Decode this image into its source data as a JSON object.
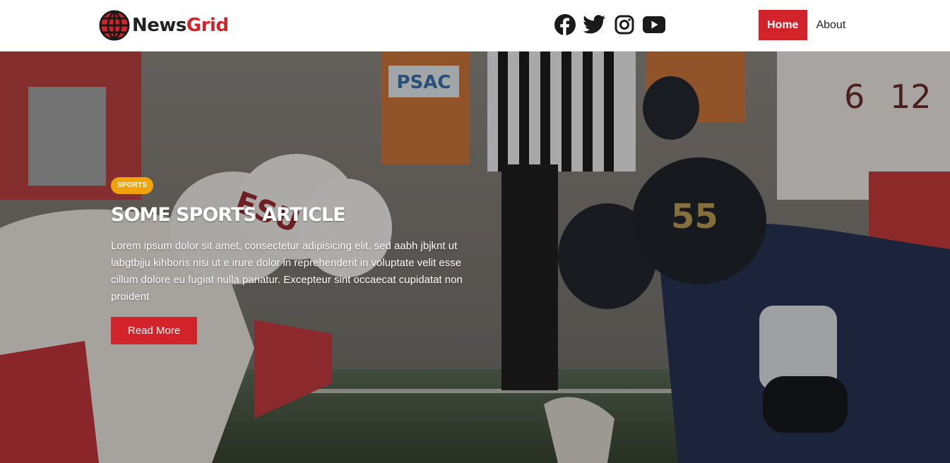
{
  "brand": {
    "name_part1": "News",
    "name_part2": "Grid",
    "logo_icon": "globe-icon",
    "accent": "#d2232a"
  },
  "social": [
    {
      "name": "facebook-icon"
    },
    {
      "name": "twitter-icon"
    },
    {
      "name": "instagram-icon"
    },
    {
      "name": "youtube-icon"
    }
  ],
  "nav": {
    "home_label": "Home",
    "about_label": "About"
  },
  "hero": {
    "category": "SPORTS",
    "category_color": "#f0a30a",
    "title": "Some Sports Article",
    "excerpt": "Lorem ipsum dolor sit amet, consectetur adipisicing elit, sed aabh jbjknt ut labgtbjju kihboris nisi ut e irure dolor in reprehenderit in voluptate velit esse cillum dolore eu fugiat nulla pariatur. Excepteur sint occaecat cupidatat non proident",
    "button_label": "Read More",
    "button_color": "#d2232a",
    "photo_helmet_left": "ESU",
    "photo_helmet_right": "55",
    "photo_banner": "PSAC",
    "photo_jersey_numbers": [
      "6",
      "12"
    ]
  }
}
